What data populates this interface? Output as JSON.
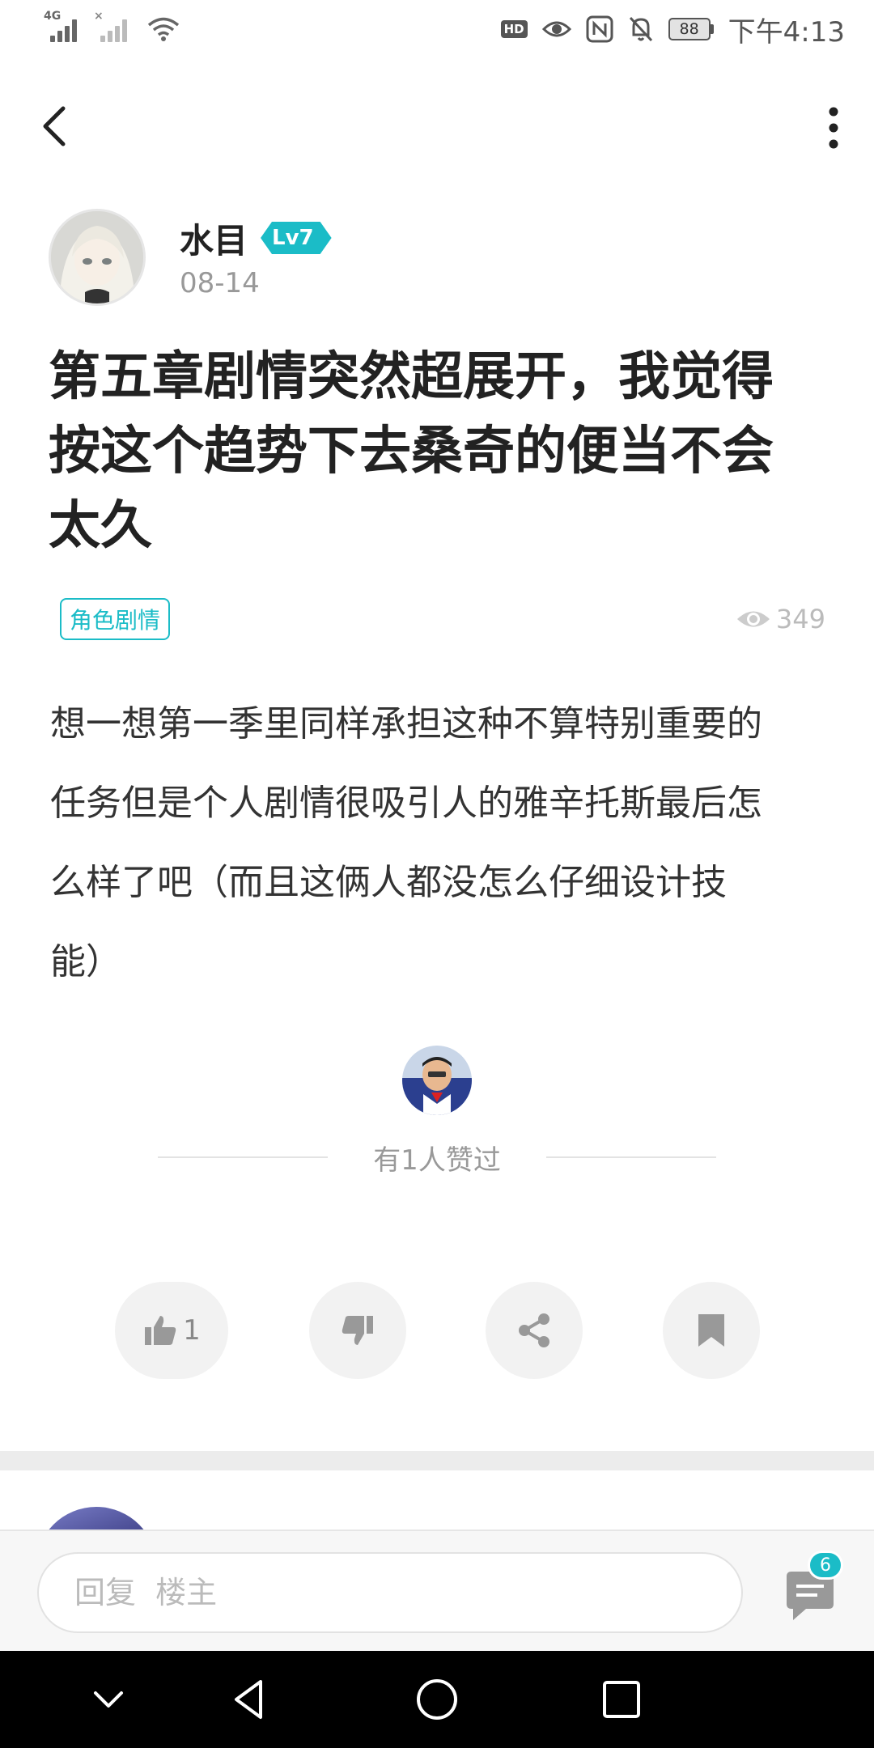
{
  "status_bar": {
    "network_label": "4G",
    "battery_level": "88",
    "time": "下午4:13",
    "icons": [
      "signal-icon",
      "signal-no-sim-icon",
      "wifi-icon",
      "hd-icon",
      "eye-icon",
      "nfc-icon",
      "bell-off-icon",
      "battery-icon"
    ]
  },
  "header": {
    "back_icon": "chevron-left-icon",
    "more_icon": "more-vertical-icon"
  },
  "post": {
    "author": {
      "name": "水目",
      "level": "Lv7"
    },
    "date": "08-14",
    "title_lines": [
      "第五章剧情突然超展开，我觉得",
      "按这个趋势下去桑奇的便当不会",
      "太久"
    ],
    "tag": "角色剧情",
    "views": "349",
    "body_lines": [
      "想一想第一季里同样承担这种不算特别重要的",
      "任务但是个人剧情很吸引人的雅辛托斯最后怎",
      "么样了吧（而且这俩人都没怎么仔细设计技",
      "能）"
    ],
    "likes_summary": "有1人赞过"
  },
  "actions": {
    "like_count": "1",
    "icons": [
      "thumbs-up-icon",
      "thumbs-down-icon",
      "share-icon",
      "bookmark-icon"
    ]
  },
  "reply": {
    "placeholder": "回复  楼主",
    "comment_count": "6"
  },
  "colors": {
    "accent": "#1bbcc7",
    "text": "#222222",
    "muted": "#999999"
  }
}
